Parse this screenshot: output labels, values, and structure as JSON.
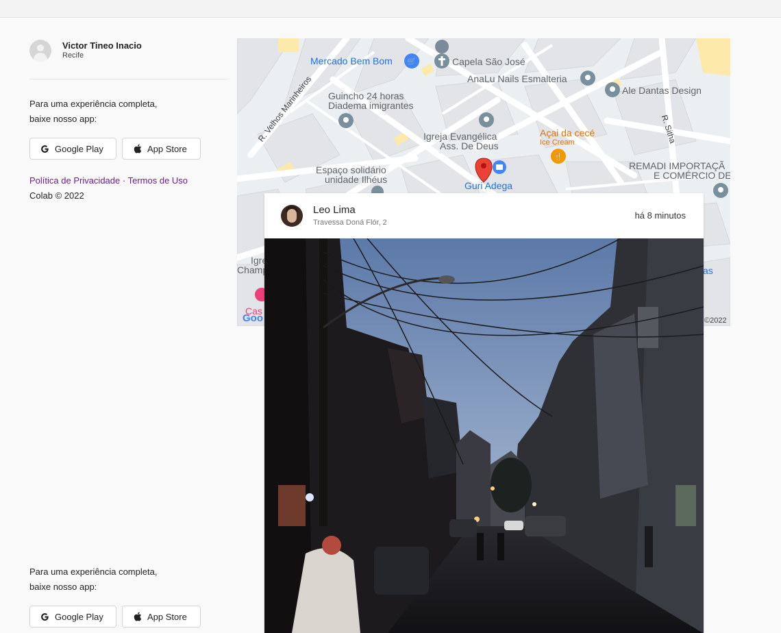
{
  "profile": {
    "name": "Victor Tineo Inacio",
    "city": "Recife"
  },
  "promo": {
    "line1": "Para uma experiência completa,",
    "line2": "baixe nosso app:"
  },
  "stores": {
    "google_play": "Google Play",
    "app_store": "App Store"
  },
  "footer": {
    "privacy": "Política de Privacidade",
    "separator": "·",
    "terms": "Termos de Uso",
    "copyright": "Colab © 2022"
  },
  "map": {
    "labels": {
      "mercado": "Mercado Bem Bom",
      "capela": "Capela São José",
      "analu": "AnaLu Nails Esmalteria",
      "ale": "Ale Dantas Design",
      "guincho1": "Guincho 24 horas",
      "guincho2": "Diadema imigrantes",
      "velhos": "R. Velhos Marinheiros",
      "igreja1": "Igreja Evangélica",
      "igreja2": "Ass. De Deus",
      "acai": "Açai da cecé",
      "icecream": "Ice Cream",
      "sitha": "R. Sitha",
      "espaco1": "Espaço solidário",
      "espaco2": "unidade Ilhéus",
      "guri": "Guri Adega",
      "remadi1": "REMADI IMPORTAÇÃ",
      "remadi2": "E COMÉRCIO DE",
      "igre": "Igre",
      "champ": "Champ",
      "cas": "Cas",
      "goo": "Goo",
      "year": "©2022",
      "as": "as"
    }
  },
  "post": {
    "author": "Leo Lima",
    "address": "Travessa Doná Flór, 2",
    "time": "há 8 minutos"
  },
  "colors": {
    "link": "#6a1b9a",
    "pin_red": "#ea4335",
    "map_bg": "#eeeeee"
  }
}
